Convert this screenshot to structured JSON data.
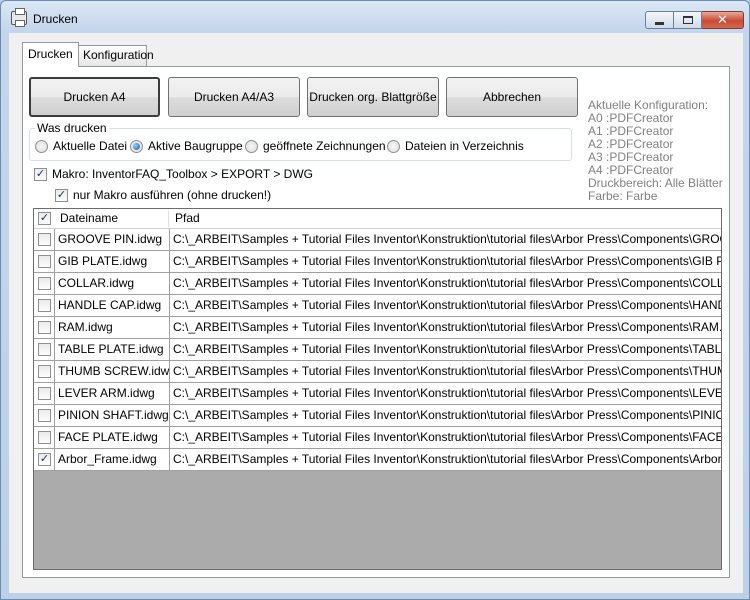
{
  "window": {
    "title": "Drucken"
  },
  "tabs": [
    {
      "label": "Drucken",
      "active": true
    },
    {
      "label": "Konfiguration",
      "active": false
    }
  ],
  "buttons": {
    "print_a4": "Drucken A4",
    "print_a4a3": "Drucken A4/A3",
    "print_orig": "Drucken org. Blattgröße",
    "cancel": "Abbrechen"
  },
  "group": {
    "title": "Was drucken",
    "options": [
      {
        "label": "Aktuelle Datei",
        "checked": false
      },
      {
        "label": "Aktive Baugruppe",
        "checked": true
      },
      {
        "label": "geöffnete Zeichnungen",
        "checked": false
      },
      {
        "label": "Dateien in Verzeichnis",
        "checked": false
      }
    ]
  },
  "macro": {
    "label": "Makro: InventorFAQ_Toolbox > EXPORT > DWG",
    "checked": true,
    "only_label": "nur Makro ausführen (ohne drucken!)",
    "only_checked": true
  },
  "config_info": [
    "Aktuelle Konfiguration:",
    "A0 :PDFCreator",
    "A1 :PDFCreator",
    "A2 :PDFCreator",
    "A3 :PDFCreator",
    "A4 :PDFCreator",
    "Druckbereich: Alle Blätter",
    "Farbe: Farbe"
  ],
  "table": {
    "header_checked": true,
    "columns": [
      "Dateiname",
      "Pfad"
    ],
    "rows": [
      {
        "checked": false,
        "name": "GROOVE PIN.idwg",
        "path": "C:\\_ARBEIT\\Samples + Tutorial Files Inventor\\Konstruktion\\tutorial files\\Arbor Press\\Components\\GROOVE PIN..."
      },
      {
        "checked": false,
        "name": "GIB PLATE.idwg",
        "path": "C:\\_ARBEIT\\Samples + Tutorial Files Inventor\\Konstruktion\\tutorial files\\Arbor Press\\Components\\GIB PLATE.d..."
      },
      {
        "checked": false,
        "name": "COLLAR.idwg",
        "path": "C:\\_ARBEIT\\Samples + Tutorial Files Inventor\\Konstruktion\\tutorial files\\Arbor Press\\Components\\COLLAR.dwg"
      },
      {
        "checked": false,
        "name": "HANDLE CAP.idwg",
        "path": "C:\\_ARBEIT\\Samples + Tutorial Files Inventor\\Konstruktion\\tutorial files\\Arbor Press\\Components\\HANDLE CA..."
      },
      {
        "checked": false,
        "name": "RAM.idwg",
        "path": "C:\\_ARBEIT\\Samples + Tutorial Files Inventor\\Konstruktion\\tutorial files\\Arbor Press\\Components\\RAM.dwg"
      },
      {
        "checked": false,
        "name": "TABLE PLATE.idwg",
        "path": "C:\\_ARBEIT\\Samples + Tutorial Files Inventor\\Konstruktion\\tutorial files\\Arbor Press\\Components\\TABLE PLAT..."
      },
      {
        "checked": false,
        "name": "THUMB SCREW.idwg",
        "path": "C:\\_ARBEIT\\Samples + Tutorial Files Inventor\\Konstruktion\\tutorial files\\Arbor Press\\Components\\THUMB SCR..."
      },
      {
        "checked": false,
        "name": "LEVER ARM.idwg",
        "path": "C:\\_ARBEIT\\Samples + Tutorial Files Inventor\\Konstruktion\\tutorial files\\Arbor Press\\Components\\LEVER ARM...."
      },
      {
        "checked": false,
        "name": "PINION SHAFT.idwg",
        "path": "C:\\_ARBEIT\\Samples + Tutorial Files Inventor\\Konstruktion\\tutorial files\\Arbor Press\\Components\\PINION SHA..."
      },
      {
        "checked": false,
        "name": "FACE PLATE.idwg",
        "path": "C:\\_ARBEIT\\Samples + Tutorial Files Inventor\\Konstruktion\\tutorial files\\Arbor Press\\Components\\FACE PLATE...."
      },
      {
        "checked": true,
        "name": "Arbor_Frame.idwg",
        "path": "C:\\_ARBEIT\\Samples + Tutorial Files Inventor\\Konstruktion\\tutorial files\\Arbor Press\\Components\\Arbor_Frame...."
      }
    ]
  },
  "icons": {
    "window": "printer-icon",
    "minimize": "minimize-icon",
    "maximize": "maximize-icon",
    "close": "close-icon"
  }
}
